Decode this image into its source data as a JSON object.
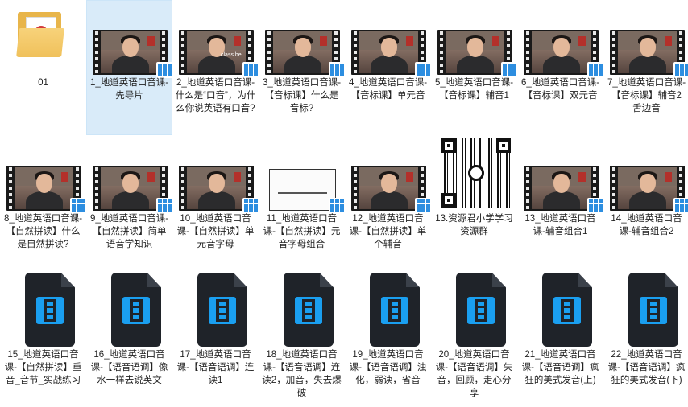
{
  "items": [
    {
      "label": "01",
      "kind": "folder"
    },
    {
      "label": "1_地道英语口音课-先导片",
      "kind": "video",
      "selected": true
    },
    {
      "label": "2_地道英语口音课-什么是“口音”，为什么你说英语有口音?",
      "kind": "video",
      "overlay_text": "class be"
    },
    {
      "label": "3_地道英语口音课-【音标课】什么是音标?",
      "kind": "video"
    },
    {
      "label": "4_地道英语口音课-【音标课】单元音",
      "kind": "video"
    },
    {
      "label": "5_地道英语口音课-【音标课】辅音1",
      "kind": "video"
    },
    {
      "label": "6_地道英语口音课-【音标课】双元音",
      "kind": "video"
    },
    {
      "label": "7_地道英语口音课-【音标课】辅音2 舌边音",
      "kind": "video"
    },
    {
      "label": "8_地道英语口音课-【自然拼读】什么是自然拼读?",
      "kind": "video"
    },
    {
      "label": "9_地道英语口音课-【自然拼读】简单语音学知识",
      "kind": "video"
    },
    {
      "label": "10_地道英语口音课-【自然拼读】单元音字母",
      "kind": "video"
    },
    {
      "label": "11_地道英语口音课-【自然拼读】元音字母组合",
      "kind": "slide"
    },
    {
      "label": "12_地道英语口音课-【自然拼读】单个辅音",
      "kind": "video"
    },
    {
      "label": "13.资源君小学学习资源群",
      "kind": "qr"
    },
    {
      "label": "13_地道英语口音课-辅音组合1",
      "kind": "video"
    },
    {
      "label": "14_地道英语口音课-辅音组合2",
      "kind": "video"
    },
    {
      "label": "15_地道英语口音课-【自然拼读】重音_音节_实战练习",
      "kind": "file"
    },
    {
      "label": "16_地道英语口音课-【语音语调】像水一样去说英文",
      "kind": "file"
    },
    {
      "label": "17_地道英语口音课-【语音语调】连读1",
      "kind": "file"
    },
    {
      "label": "18_地道英语口音课-【语音语调】连读2，加音，失去爆破",
      "kind": "file"
    },
    {
      "label": "19_地道英语口音课-【语音语调】浊化，弱读，省音",
      "kind": "file"
    },
    {
      "label": "20_地道英语口音课-【语音语调】失音，回顾，走心分享",
      "kind": "file"
    },
    {
      "label": "21_地道英语口音课-【语音语调】疯狂的美式发音(上)",
      "kind": "file"
    },
    {
      "label": "22_地道英语口音课-【语音语调】疯狂的美式发音(下)",
      "kind": "file"
    }
  ],
  "colors": {
    "selection": "#d9ebf9",
    "file_accent": "#1a9ff0",
    "folder": "#f0c15b"
  },
  "icons": {
    "folder": "folder-icon",
    "video": "video-thumbnail-icon",
    "slide": "slide-thumbnail-icon",
    "qr": "qr-code-image",
    "file": "video-file-icon",
    "badge": "video-file-badge-icon"
  }
}
